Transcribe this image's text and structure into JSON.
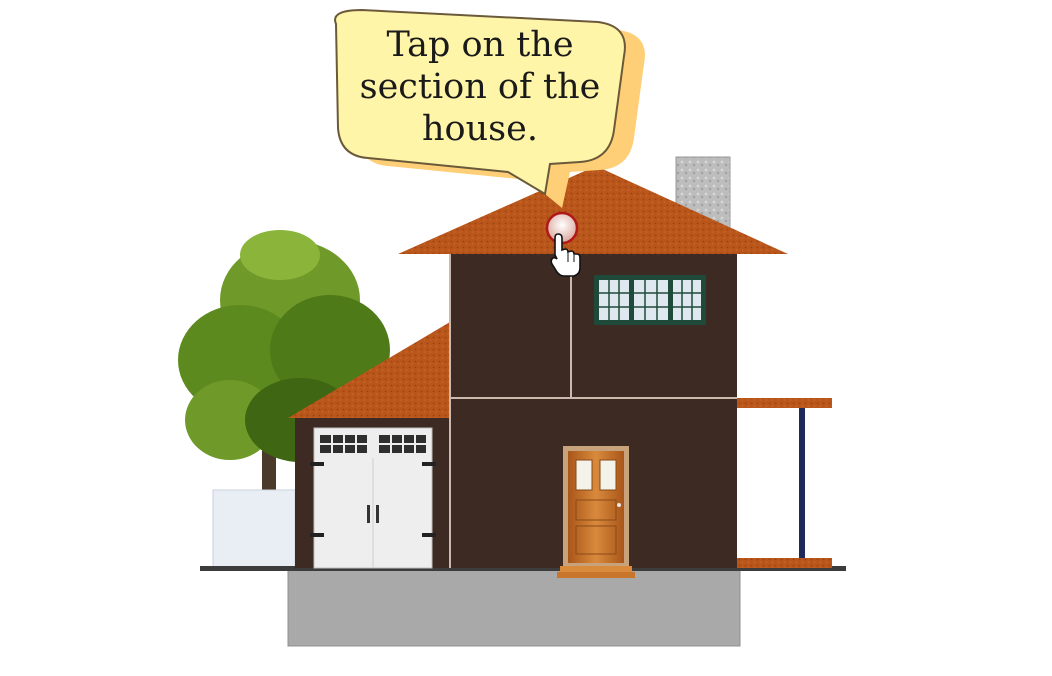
{
  "instruction": {
    "text": "Tap on the section of the house."
  },
  "hint": {
    "target": "roof",
    "cursor_icon": "hand-pointer-icon"
  },
  "colors": {
    "wall": "#3d2b23",
    "roof": "#b9561c",
    "bubble_fill": "#fff5a8",
    "bubble_shadow": "#ffcf77",
    "door": "#c86c24",
    "foundation": "#a9a9a9",
    "chimney": "#b8b8b8",
    "tree": "#5c8a1e",
    "post": "#1d2a5a"
  }
}
